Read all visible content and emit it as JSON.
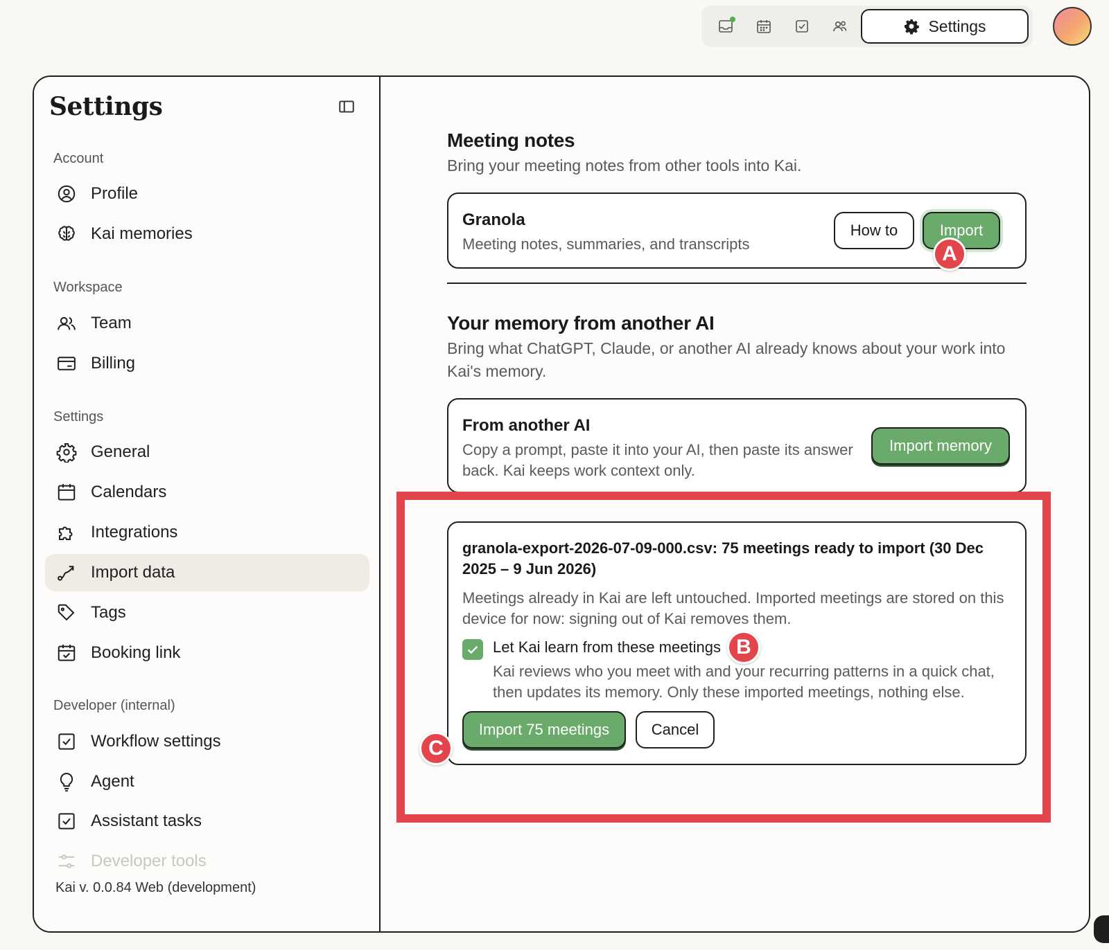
{
  "topbar": {
    "icons": [
      "inbox-icon",
      "calendar-icon",
      "checkbox-icon",
      "people-icon"
    ],
    "settings_label": "Settings"
  },
  "sidebar": {
    "title": "Settings",
    "sections": {
      "account": "Account",
      "workspace": "Workspace",
      "settings": "Settings",
      "developer": "Developer (internal)"
    },
    "items": {
      "profile": "Profile",
      "kai_memories": "Kai memories",
      "team": "Team",
      "billing": "Billing",
      "general": "General",
      "calendars": "Calendars",
      "integrations": "Integrations",
      "import_data": "Import data",
      "tags": "Tags",
      "booking_link": "Booking link",
      "workflow_settings": "Workflow settings",
      "agent": "Agent",
      "assistant_tasks": "Assistant tasks",
      "developer_tools": "Developer tools"
    },
    "active": "import_data",
    "version": "Kai v. 0.0.84 Web (development)"
  },
  "main": {
    "meeting_notes": {
      "title": "Meeting notes",
      "subtitle": "Bring your meeting notes from other tools into Kai.",
      "granola": {
        "title": "Granola",
        "desc": "Meeting notes, summaries, and transcripts",
        "howto_label": "How to",
        "import_label": "Import"
      }
    },
    "memory": {
      "title": "Your memory from another AI",
      "subtitle": "Bring what ChatGPT, Claude, or another AI already knows about your work into Kai's memory.",
      "card": {
        "title": "From another AI",
        "desc": "Copy a prompt, paste it into your AI, then paste its answer back. Kai keeps work context only.",
        "button_label": "Import memory"
      }
    },
    "import_preview": {
      "title": "granola-export-2026-07-09-000.csv: 75 meetings ready to import (30 Dec 2025 – 9 Jun 2026)",
      "desc": "Meetings already in Kai are left untouched. Imported meetings are stored on this device for now: signing out of Kai removes them.",
      "checkbox_label": "Let Kai learn from these meetings",
      "checkbox_checked": true,
      "checkbox_desc": "Kai reviews who you meet with and your recurring patterns in a quick chat, then updates its memory. Only these imported meetings, nothing else.",
      "import_button": "Import 75 meetings",
      "cancel_button": "Cancel"
    },
    "annotations": {
      "a": "A",
      "b": "B",
      "c": "C"
    }
  },
  "colors": {
    "accent_green": "#6aaa6b",
    "annotation_red": "#e2454c",
    "border": "#1f1f1f"
  }
}
